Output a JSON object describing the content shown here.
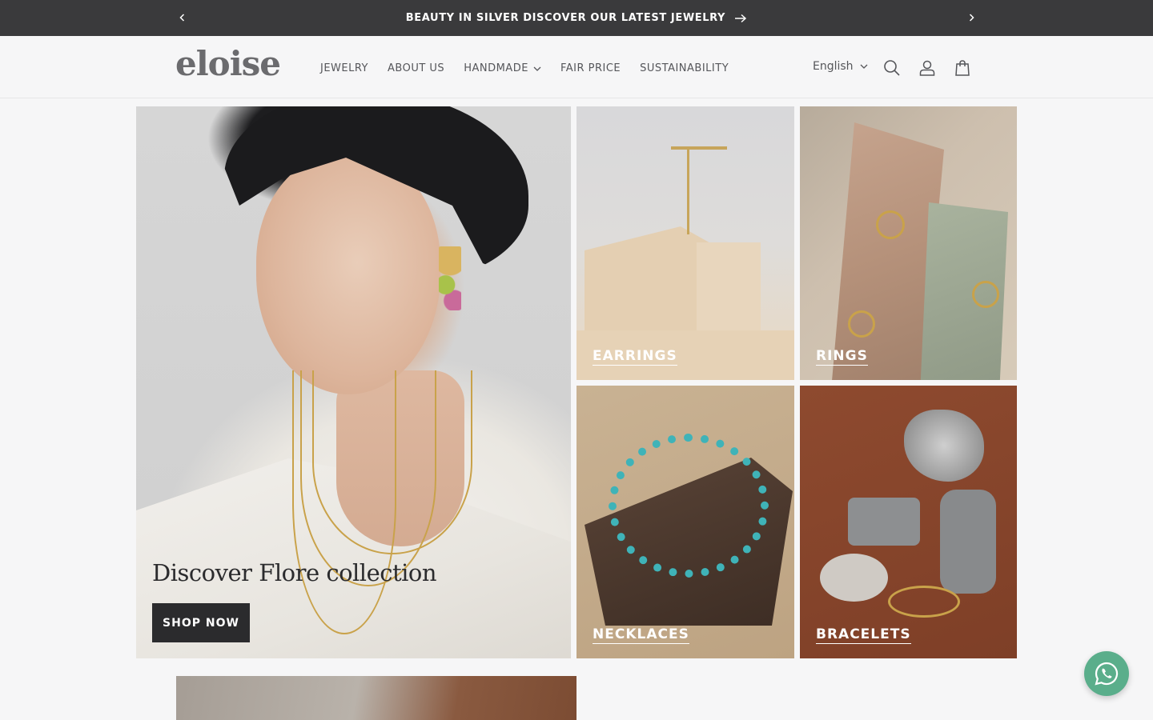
{
  "announcement": {
    "text": "BEAUTY IN SILVER DISCOVER OUR LATEST JEWELRY"
  },
  "header": {
    "logo": "eloise",
    "nav": [
      {
        "label": "JEWELRY"
      },
      {
        "label": "ABOUT US"
      },
      {
        "label": "HANDMADE"
      },
      {
        "label": "FAIR PRICE"
      },
      {
        "label": "SUSTAINABILITY"
      }
    ],
    "language": "English"
  },
  "hero": {
    "title": "Discover Flore collection",
    "button": "SHOP NOW"
  },
  "categories": [
    {
      "label": "EARRINGS"
    },
    {
      "label": "RINGS"
    },
    {
      "label": "NECKLACES"
    },
    {
      "label": "BRACELETS"
    }
  ],
  "colors": {
    "announcement_bg": "#3a3a3c",
    "button_bg": "#2b2b2d",
    "whatsapp": "#5aae8b"
  },
  "icons": [
    "chevron-left-icon",
    "chevron-right-icon",
    "arrow-right-icon",
    "chevron-down-icon",
    "search-icon",
    "account-icon",
    "cart-icon",
    "whatsapp-icon"
  ]
}
